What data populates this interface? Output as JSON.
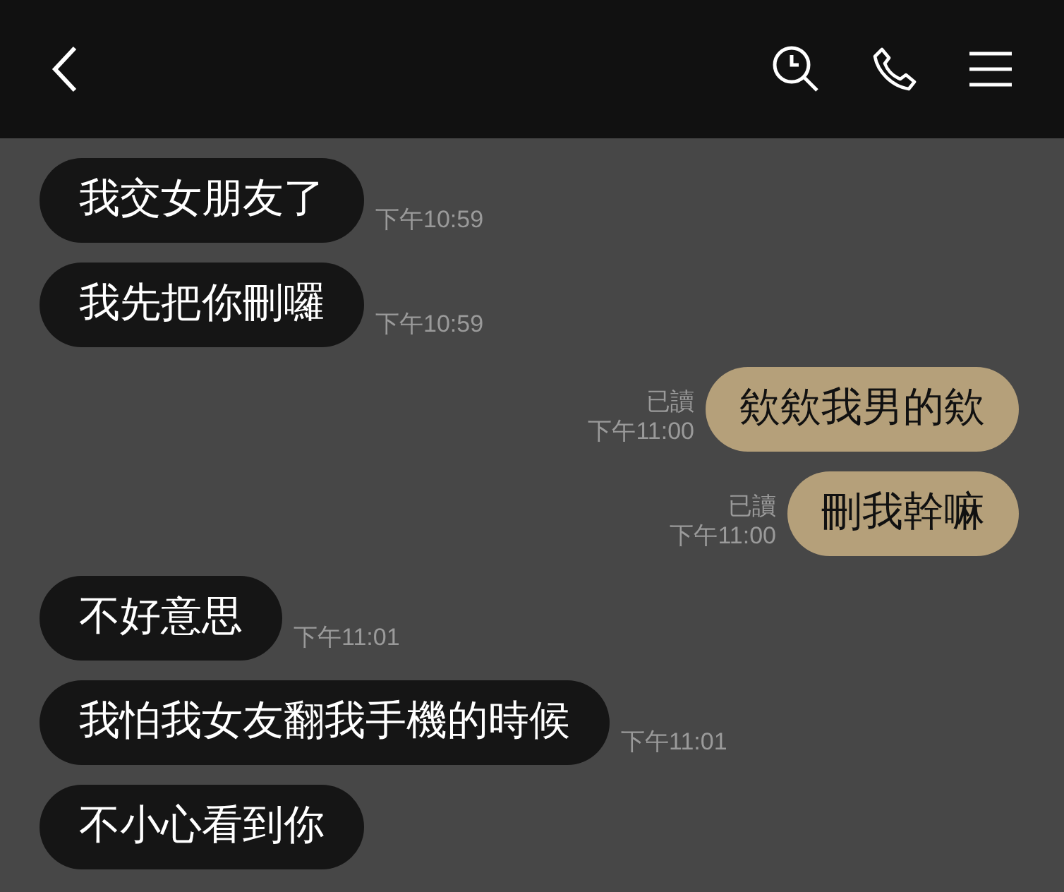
{
  "messages": [
    {
      "kind": "received",
      "text": "我交女朋友了",
      "time": "下午10:59"
    },
    {
      "kind": "received",
      "text": "我先把你刪囉",
      "time": "下午10:59"
    },
    {
      "kind": "sent",
      "text": "欸欸我男的欸",
      "time": "下午11:00",
      "status": "已讀"
    },
    {
      "kind": "sent",
      "text": "刪我幹嘛",
      "time": "下午11:00",
      "status": "已讀"
    },
    {
      "kind": "received",
      "text": "不好意思",
      "time": "下午11:01"
    },
    {
      "kind": "received",
      "text": "我怕我女友翻我手機的時候",
      "time": "下午11:01"
    },
    {
      "kind": "received",
      "text": "不小心看到你"
    }
  ]
}
